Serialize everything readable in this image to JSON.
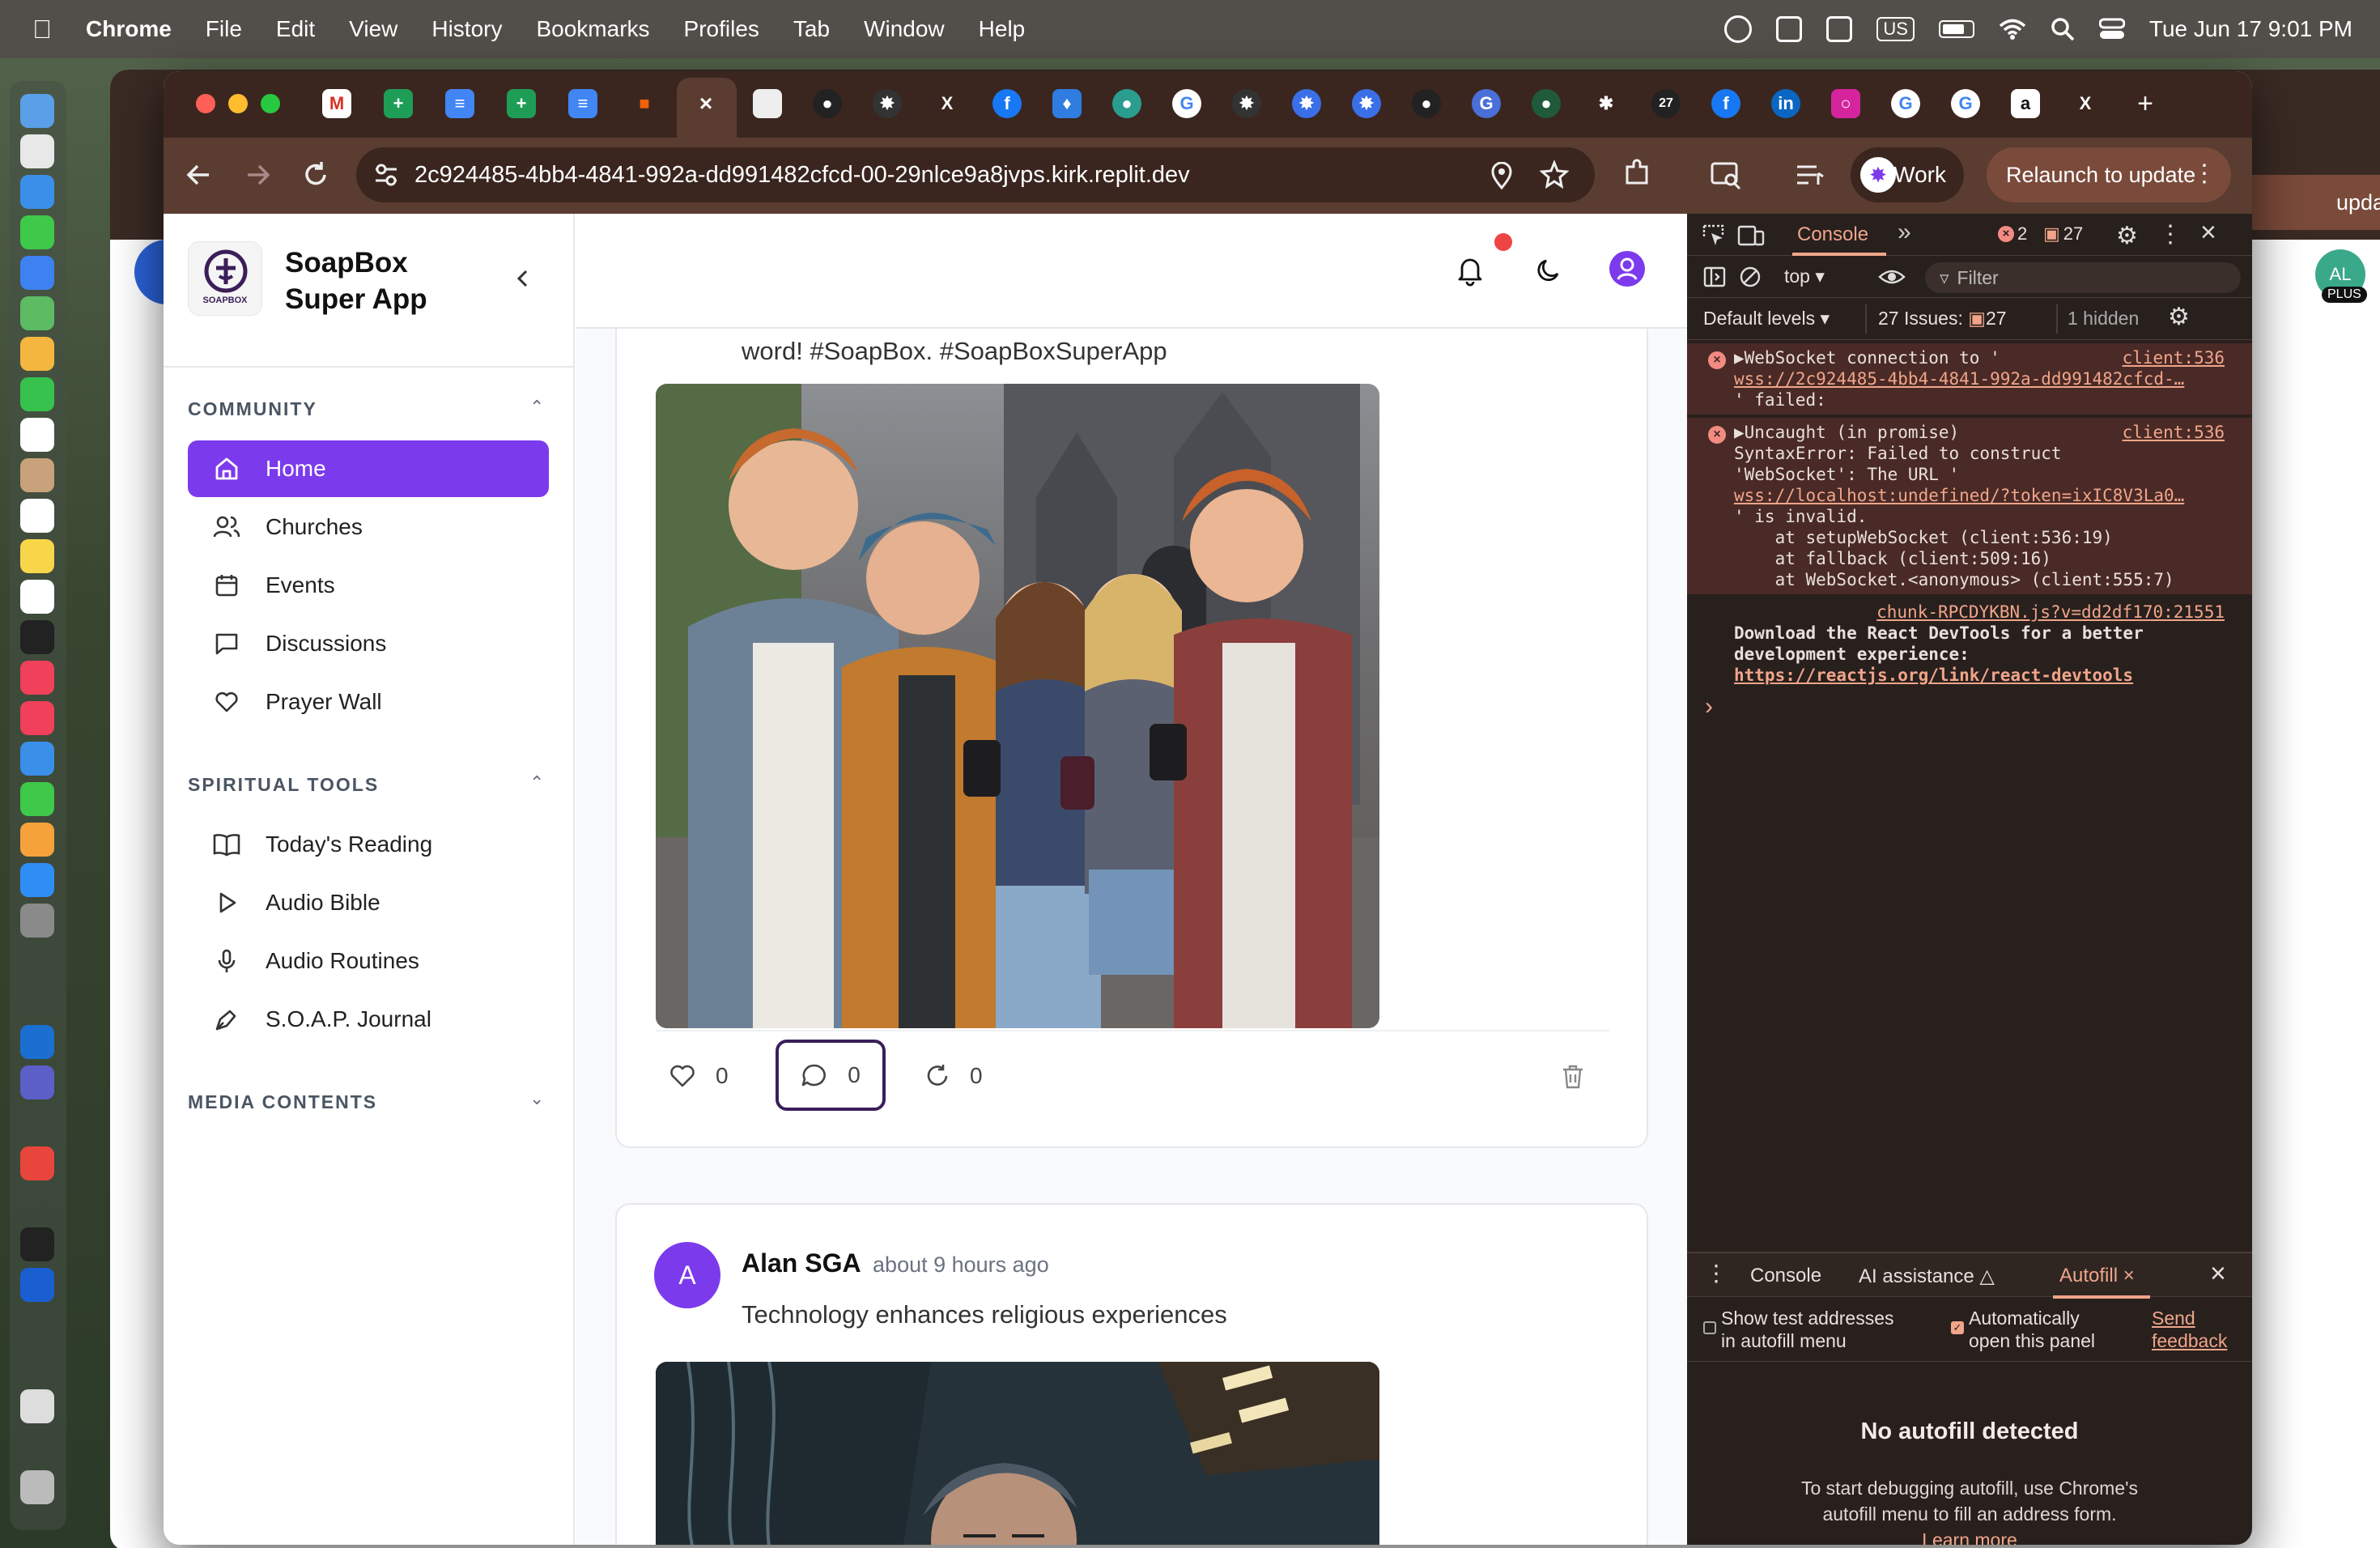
{
  "menubar": {
    "app": "Chrome",
    "items": [
      "File",
      "Edit",
      "View",
      "History",
      "Bookmarks",
      "Profiles",
      "Tab",
      "Window",
      "Help"
    ],
    "input_source": "US",
    "clock": "Tue Jun 17  9:01 PM"
  },
  "browser": {
    "url": "2c924485-4bb4-4841-992a-dd991482cfcd-00-29nlce9a8jvps.kirk.replit.dev",
    "profile_label": "Work",
    "relaunch_label": "Relaunch to update",
    "back_window_relaunch": "update",
    "back_window_avatar": "AL",
    "back_window_badge": "PLUS",
    "tab_badge": "27"
  },
  "app": {
    "logo_text": "SOAPBOX",
    "name_line1": "SoapBox",
    "name_line2": "Super App",
    "community_heading": "COMMUNITY",
    "community_items": [
      {
        "label": "Home",
        "icon": "home-icon"
      },
      {
        "label": "Churches",
        "icon": "users-icon"
      },
      {
        "label": "Events",
        "icon": "calendar-icon"
      },
      {
        "label": "Discussions",
        "icon": "message-icon"
      },
      {
        "label": "Prayer Wall",
        "icon": "heart-icon"
      }
    ],
    "spiritual_heading": "SPIRITUAL TOOLS",
    "spiritual_items": [
      {
        "label": "Today's Reading",
        "icon": "book-icon"
      },
      {
        "label": "Audio Bible",
        "icon": "play-icon"
      },
      {
        "label": "Audio Routines",
        "icon": "microphone-icon"
      },
      {
        "label": "S.O.A.P. Journal",
        "icon": "pen-icon"
      }
    ],
    "media_heading": "MEDIA CONTENTS"
  },
  "feed": {
    "post1": {
      "text_tail": "word! #SoapBox. #SoapBoxSuperApp",
      "likes": "0",
      "comments": "0",
      "shares": "0"
    },
    "post2": {
      "avatar_letter": "A",
      "author": "Alan SGA",
      "time": "about 9 hours ago",
      "text": "Technology enhances religious experiences"
    }
  },
  "devtools": {
    "tab_console": "Console",
    "error_count": "2",
    "issue_count": "27",
    "context": "top",
    "filter_placeholder": "Filter",
    "levels": "Default levels",
    "issues_label": "27 Issues:",
    "issues_badge": "27",
    "hidden": "1 hidden",
    "logs": [
      {
        "src": "client:536",
        "lines": [
          "▶WebSocket connection to '",
          "wss://2c924485-4bb4-4841-992a-dd991482cfcd-…",
          "' failed:"
        ]
      },
      {
        "src": "client:536",
        "lines": [
          "▶Uncaught (in promise)",
          "SyntaxError: Failed to construct",
          "'WebSocket': The URL '",
          "wss://localhost:undefined/?token=ixIC8V3La0…",
          "' is invalid.",
          "    at setupWebSocket (client:536:19)",
          "    at fallback (client:509:16)",
          "    at WebSocket.<anonymous> (client:555:7)"
        ]
      }
    ],
    "info_src": "chunk-RPCDYKBN.js?v=dd2df170:21551",
    "info_line1": "Download the React DevTools for a better",
    "info_line2": "development experience:",
    "info_link": "https://reactjs.org/link/react-devtools",
    "prompt": "›",
    "drawer_tabs": [
      "Console",
      "AI assistance",
      "Autofill"
    ],
    "opt1_line1": "Show test addresses",
    "opt1_line2": "in autofill menu",
    "opt2_line1": "Automatically",
    "opt2_line2": "open this panel",
    "send_line1": "Send",
    "send_line2": "feedback",
    "empty_title": "No autofill detected",
    "empty_line1": "To start debugging autofill, use Chrome's",
    "empty_line2": "autofill menu to fill an address form.",
    "learn_more": "Learn more"
  },
  "colors": {
    "accent": "#7c3aed",
    "tab_strip": "#3a261f",
    "toolbar": "#5a3c31",
    "devtools_bg": "#28201d",
    "error_bg": "#4a2a26"
  }
}
